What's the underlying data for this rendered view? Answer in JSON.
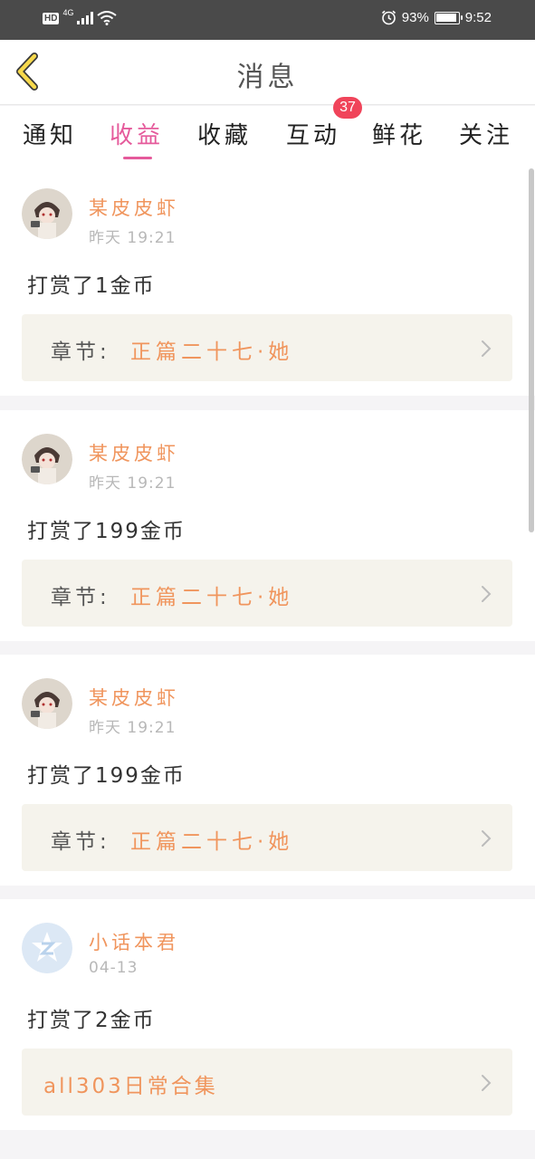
{
  "status_bar": {
    "hd": "HD",
    "network": "4G",
    "battery_text": "93%",
    "battery_level": 0.93,
    "time": "9:52"
  },
  "header": {
    "title": "消息"
  },
  "tabs": [
    {
      "label": "通知",
      "active": false
    },
    {
      "label": "收益",
      "active": true
    },
    {
      "label": "收藏",
      "active": false
    },
    {
      "label": "互动",
      "active": false,
      "badge": "37"
    },
    {
      "label": "鲜花",
      "active": false
    },
    {
      "label": "关注",
      "active": false
    }
  ],
  "messages": [
    {
      "user": "某皮皮虾",
      "time": "昨天 19:21",
      "action": "打赏了1金币",
      "chapter_label": "章节:",
      "chapter_title": "正篇二十七·她"
    },
    {
      "user": "某皮皮虾",
      "time": "昨天 19:21",
      "action": "打赏了199金币",
      "chapter_label": "章节:",
      "chapter_title": "正篇二十七·她"
    },
    {
      "user": "某皮皮虾",
      "time": "昨天 19:21",
      "action": "打赏了199金币",
      "chapter_label": "章节:",
      "chapter_title": "正篇二十七·她"
    },
    {
      "user": "小话本君",
      "time": "04-13",
      "action": "打赏了2金币",
      "chapter_label": "",
      "chapter_title": "all303日常合集"
    }
  ],
  "colors": {
    "accent_pink": "#e55a9b",
    "name_orange": "#f0955d",
    "badge_red": "#f0445a",
    "back_yellow": "#f7d94c"
  },
  "icons": {
    "back": "chevron-left-icon",
    "chapter_arrow": "chevron-right-icon",
    "wifi": "wifi-icon",
    "signal": "signal-icon",
    "alarm": "alarm-icon",
    "battery": "battery-icon"
  }
}
